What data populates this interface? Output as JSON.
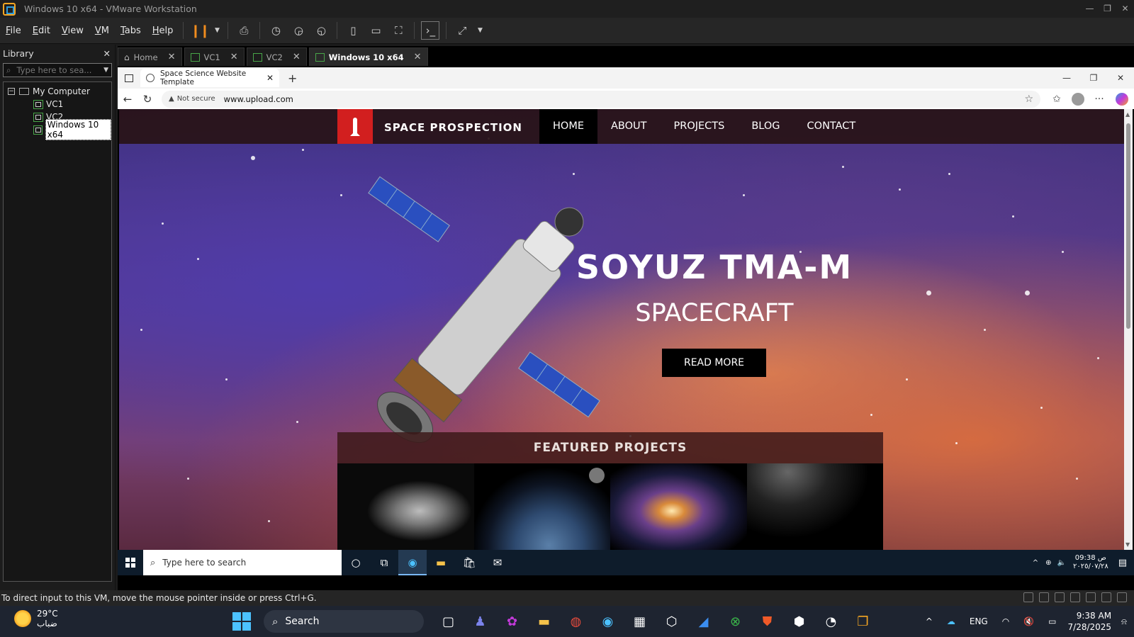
{
  "vmware": {
    "title": "Windows 10 x64 - VMware Workstation",
    "menu": [
      "File",
      "Edit",
      "View",
      "VM",
      "Tabs",
      "Help"
    ],
    "library": {
      "title": "Library",
      "search_placeholder": "Type here to sea...",
      "tree": {
        "root": "My Computer",
        "children": [
          "VC1",
          "VC2",
          "Windows 10 x64"
        ]
      }
    },
    "tabs": [
      {
        "label": "Home"
      },
      {
        "label": "VC1"
      },
      {
        "label": "VC2"
      },
      {
        "label": "Windows 10 x64",
        "active": true
      }
    ],
    "status_text": "To direct input to this VM, move the mouse pointer inside or press Ctrl+G."
  },
  "browser": {
    "tab_title": "Space Science Website Template",
    "not_secure": "Not secure",
    "url": "www.upload.com"
  },
  "site": {
    "brand": "SPACE PROSPECTION",
    "nav": [
      "HOME",
      "ABOUT",
      "PROJECTS",
      "BLOG",
      "CONTACT"
    ],
    "active_nav": "HOME",
    "hero_title": "SOYUZ TMA-M",
    "hero_subtitle": "SPACECRAFT",
    "cta": "READ MORE",
    "featured_title": "FEATURED PROJECTS"
  },
  "guest_taskbar": {
    "search_placeholder": "Type here to search",
    "clock_time": "09:38 ص",
    "clock_date": "٢٠٢٥/٠٧/٢٨"
  },
  "host_taskbar": {
    "temperature": "29°C",
    "weather_desc": "ضباب",
    "search_label": "Search",
    "language": "ENG",
    "time": "9:38 AM",
    "date": "7/28/2025"
  },
  "colors": {
    "accent_red": "#d21f1f",
    "vm_pause_orange": "#f08c1e"
  }
}
